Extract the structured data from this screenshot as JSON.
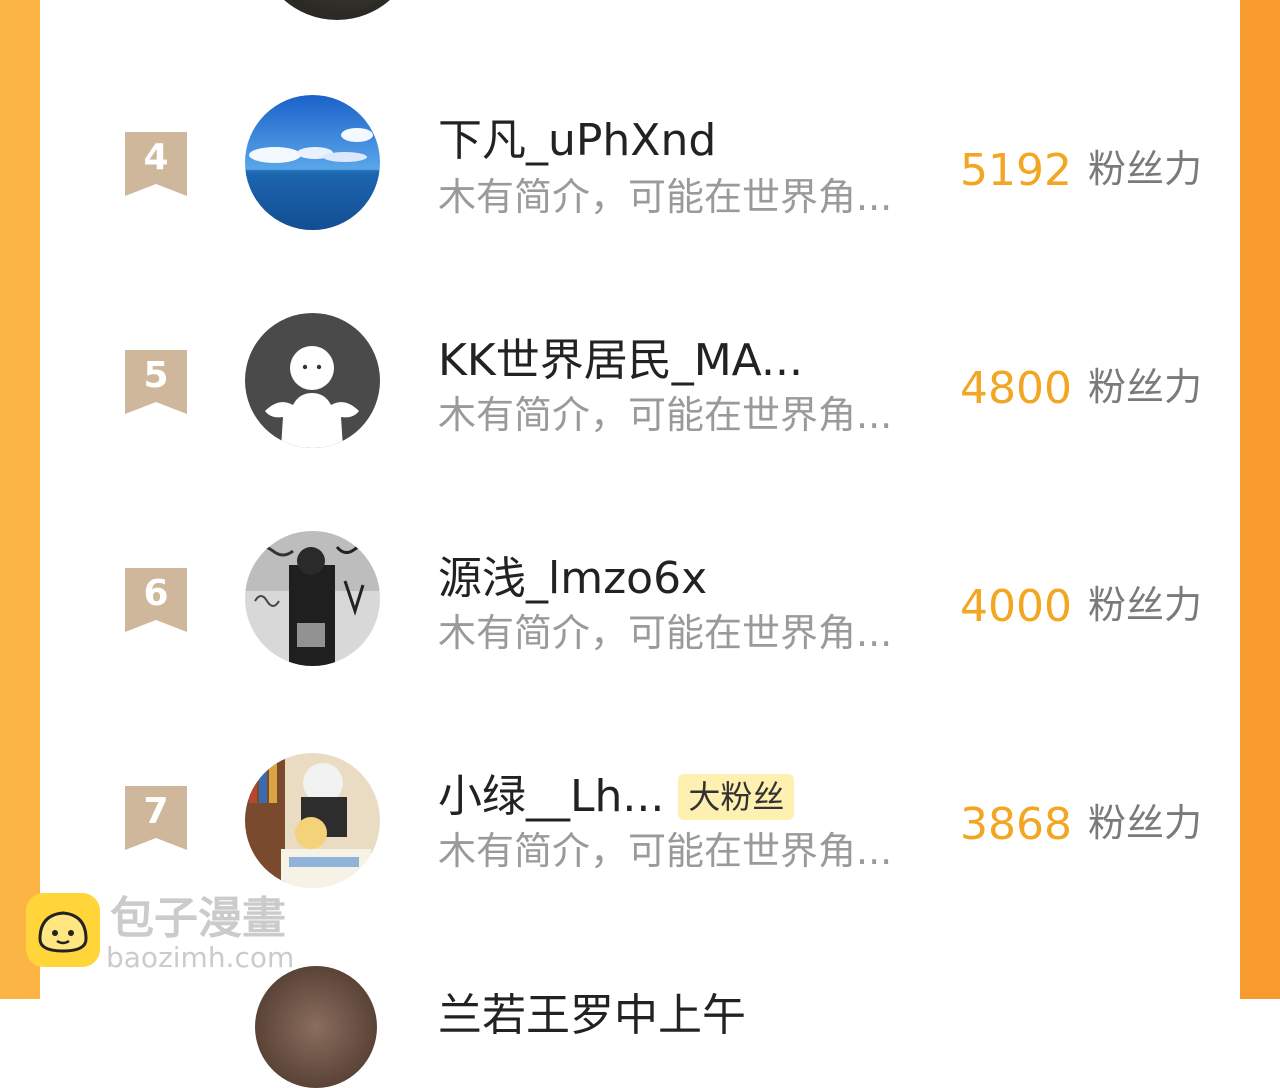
{
  "colors": {
    "accent": "#f2a623",
    "border_orange": "#fba93c",
    "badge_bronze": "#ceb79b",
    "tag_bg": "#fdf0b0",
    "intro_gray": "#9a9a9a"
  },
  "score_label": "粉丝力",
  "entries": [
    {
      "rank": "4",
      "name": "下凡_uPhXnd",
      "intro": "木有简介，可能在世界角...",
      "score": "5192",
      "avatar_icon": "ocean-sky-avatar"
    },
    {
      "rank": "5",
      "name": "KK世界居民_MA...",
      "intro": "木有简介，可能在世界角...",
      "score": "4800",
      "avatar_icon": "default-user-avatar"
    },
    {
      "rank": "6",
      "name": "源浅_lmzo6x",
      "intro": "木有简介，可能在世界角...",
      "score": "4000",
      "avatar_icon": "graffiti-photo-avatar"
    },
    {
      "rank": "7",
      "name": "小绿__Lh...",
      "tag": "大粉丝",
      "intro": "木有简介，可能在世界角...",
      "score": "3868",
      "avatar_icon": "anime-avatar"
    }
  ],
  "next_entry_name_partial": "兰若王罗中上午",
  "watermark": {
    "title": "包子漫畫",
    "url": "baozimh.com"
  }
}
